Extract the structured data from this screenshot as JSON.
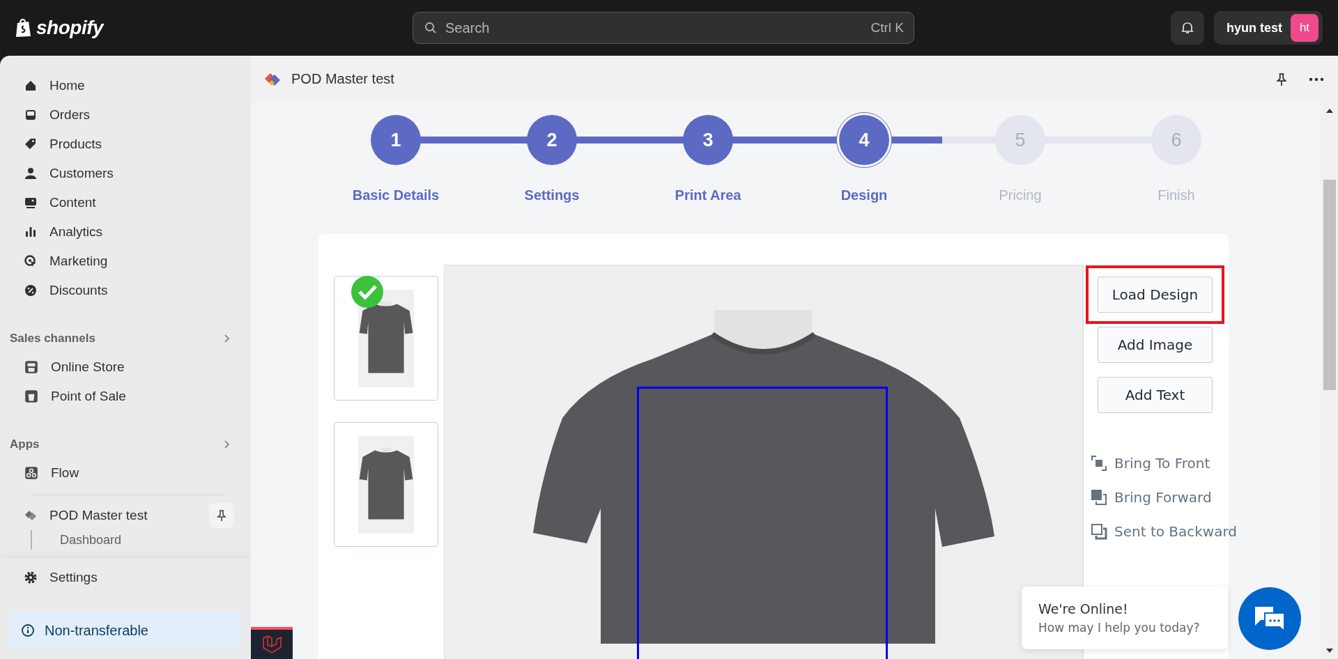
{
  "topbar": {
    "brand": "shopify",
    "search": {
      "placeholder": "Search",
      "shortcut": "Ctrl K"
    },
    "user": {
      "name": "hyun test",
      "initials": "ht"
    }
  },
  "sidebar": {
    "items": [
      {
        "label": "Home"
      },
      {
        "label": "Orders"
      },
      {
        "label": "Products"
      },
      {
        "label": "Customers"
      },
      {
        "label": "Content"
      },
      {
        "label": "Analytics"
      },
      {
        "label": "Marketing"
      },
      {
        "label": "Discounts"
      }
    ],
    "sections": [
      {
        "title": "Sales channels",
        "items": [
          {
            "label": "Online Store"
          },
          {
            "label": "Point of Sale"
          }
        ]
      },
      {
        "title": "Apps",
        "items": [
          {
            "label": "Flow"
          }
        ]
      }
    ],
    "app": {
      "label": "POD Master test",
      "children": [
        {
          "label": "Dashboard"
        }
      ]
    },
    "settings": "Settings",
    "plan_badge": "Non-transferable"
  },
  "app_header": {
    "title": "POD Master test"
  },
  "stepper": {
    "level": 0.7,
    "steps": [
      {
        "number": "1",
        "label": "Basic Details",
        "completed": true,
        "selected": false
      },
      {
        "number": "2",
        "label": "Settings",
        "completed": true,
        "selected": false
      },
      {
        "number": "3",
        "label": "Print Area",
        "completed": true,
        "selected": false
      },
      {
        "number": "4",
        "label": "Design",
        "completed": true,
        "selected": true
      },
      {
        "number": "5",
        "label": "Pricing",
        "completed": false,
        "selected": false
      },
      {
        "number": "6",
        "label": "Finish",
        "completed": false,
        "selected": false
      }
    ]
  },
  "designer": {
    "views": [
      {
        "selected": true
      },
      {
        "selected": false
      }
    ],
    "actions": [
      {
        "label": "Load Design",
        "highlighted": true
      },
      {
        "label": "Add Image",
        "highlighted": false
      },
      {
        "label": "Add Text",
        "highlighted": false
      }
    ],
    "layer_tools": [
      "Bring To Front",
      "Bring Forward",
      "Sent to Backward"
    ]
  },
  "chat": {
    "title": "We're Online!",
    "message": "How may I help you today?"
  }
}
